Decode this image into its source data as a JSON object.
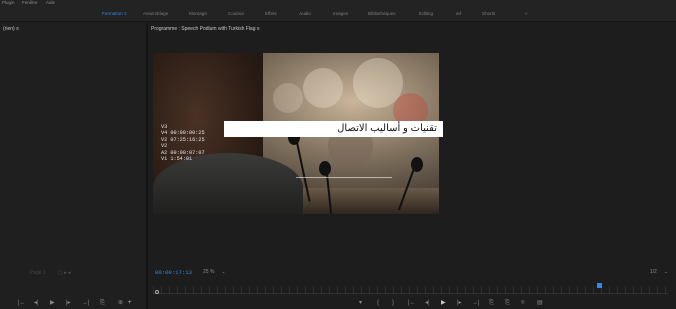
{
  "menubar": {
    "items": [
      "Plugin",
      "Fenêtre",
      "Aide"
    ]
  },
  "workspaces": {
    "items": [
      "Formation",
      "Assemblage",
      "Montage",
      "Couleur",
      "Effets",
      "Audio",
      "Images",
      "Bibliothèques",
      "Editing",
      "ed",
      "Shorts"
    ],
    "active_index": 0,
    "active_marker": "≡",
    "overflow": "»"
  },
  "source_panel": {
    "tab_label": "(rien)",
    "tab_menu": "≡",
    "timecode": "Page 1",
    "marker": "▢ ▸ ◂"
  },
  "program_panel": {
    "tab_label": "Programme : Speech Podium with Turkish Flag",
    "tab_menu": "≡",
    "playhead_timecode": "00:00:17:13",
    "zoom_label": "25 %",
    "zoom_caret": "⌄",
    "quality_label": "1/2",
    "quality_caret": "⌄"
  },
  "video": {
    "title_text": "تقنيات و أساليب الاتصال",
    "timecode_overlay": [
      "V3",
      "V4 00:00:00:25",
      "V2 07:25:16:25",
      "V2",
      "A2 00:00:07:07",
      "V1 1:54:01"
    ]
  },
  "transport": {
    "left": [
      "|←",
      "◂|",
      "▶",
      "|▸",
      "→|",
      "⎘",
      "⊕",
      "+"
    ],
    "center": [
      "▾",
      "{",
      "}",
      "|←",
      "◂|",
      "▶",
      "|▸",
      "→|",
      "⎘",
      "⎘",
      "⌾",
      "▤"
    ]
  },
  "colors": {
    "accent": "#2d8ceb",
    "panel_bg": "#1d1d1d",
    "title_card_bg": "#ffffff"
  }
}
